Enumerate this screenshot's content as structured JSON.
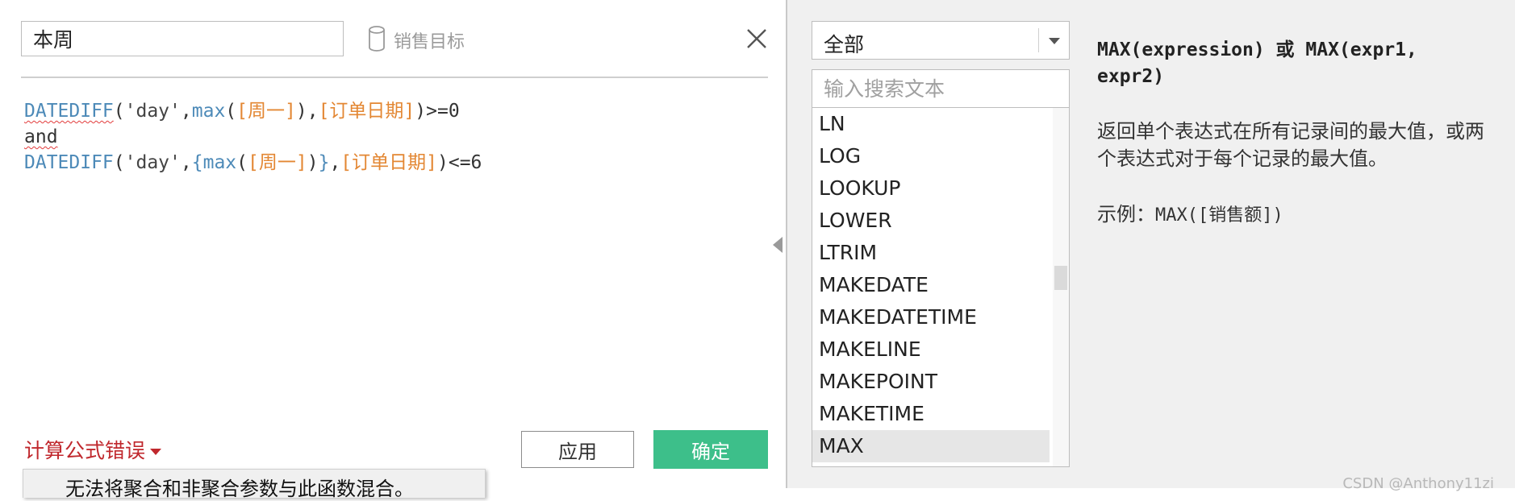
{
  "editor": {
    "calc_name": "本周",
    "datasource_label": "销售目标",
    "formula": {
      "line1": {
        "func": "DATEDIFF",
        "open": "(",
        "str": "'day'",
        "comma1": ",",
        "func2": "max",
        "open2": "(",
        "field1": "[周一]",
        "close2": ")",
        "comma2": ",",
        "field2": "[订单日期]",
        "close": ")",
        "op": ">=0"
      },
      "line2": "and",
      "line3": {
        "func": "DATEDIFF",
        "open": "(",
        "str": "'day'",
        "comma1": ",",
        "brace_open": "{",
        "func2": "max",
        "open2": "(",
        "field1": "[周一]",
        "close2": ")",
        "brace_close": "}",
        "comma2": ",",
        "field2": "[订单日期]",
        "close": ")",
        "op": "<=6"
      }
    },
    "error_label": "计算公式错误",
    "apply_label": "应用",
    "ok_label": "确定",
    "error_tooltip": "无法将聚合和非聚合参数与此函数混合。"
  },
  "functions_panel": {
    "category_value": "全部",
    "search_placeholder": "输入搜索文本",
    "items": [
      "LN",
      "LOG",
      "LOOKUP",
      "LOWER",
      "LTRIM",
      "MAKEDATE",
      "MAKEDATETIME",
      "MAKELINE",
      "MAKEPOINT",
      "MAKETIME",
      "MAX"
    ],
    "selected": "MAX"
  },
  "help": {
    "signature": "MAX(expression) 或 MAX(expr1, expr2)",
    "description": "返回单个表达式在所有记录间的最大值，或两个表达式对于每个记录的最大值。",
    "example_label": "示例：",
    "example_code": "MAX([销售额])"
  },
  "watermark": "CSDN @Anthony11zi",
  "colors": {
    "ok_button": "#3dbf8a",
    "error_text": "#c0282d",
    "function_keyword": "#4d8ab8",
    "field_reference": "#e38733"
  }
}
